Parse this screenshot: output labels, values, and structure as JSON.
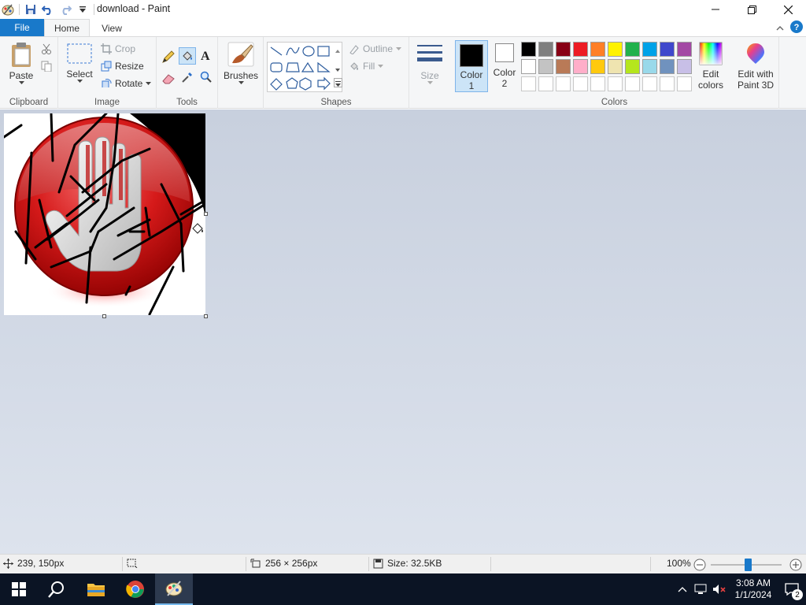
{
  "window": {
    "title": "download - Paint"
  },
  "tabs": {
    "file": "File",
    "home": "Home",
    "view": "View"
  },
  "clipboard": {
    "paste": "Paste",
    "label": "Clipboard"
  },
  "image_group": {
    "select": "Select",
    "crop": "Crop",
    "resize": "Resize",
    "rotate": "Rotate",
    "label": "Image"
  },
  "tools": {
    "label": "Tools"
  },
  "brushes": {
    "label": "Brushes"
  },
  "shapes": {
    "outline": "Outline",
    "fill": "Fill",
    "label": "Shapes"
  },
  "size": {
    "label": "Size"
  },
  "colors": {
    "color1_label": "Color",
    "color1_num": "1",
    "color2_label": "Color",
    "color2_num": "2",
    "edit_colors_line1": "Edit",
    "edit_colors_line2": "colors",
    "paint3d_line1": "Edit with",
    "paint3d_line2": "Paint 3D",
    "label": "Colors",
    "color1_value": "#000000",
    "color2_value": "#ffffff",
    "palette_row1": [
      "#000000",
      "#7f7f7f",
      "#880015",
      "#ed1c24",
      "#ff7f27",
      "#fff200",
      "#22b14c",
      "#00a2e8",
      "#3f48cc",
      "#a349a4"
    ],
    "palette_row2": [
      "#ffffff",
      "#c3c3c3",
      "#b97a57",
      "#ffaec9",
      "#ffc90e",
      "#efe4b0",
      "#b5e61d",
      "#99d9ea",
      "#7092be",
      "#c8bfe7"
    ],
    "palette_row3": [
      "#ffffff",
      "#ffffff",
      "#ffffff",
      "#ffffff",
      "#ffffff",
      "#ffffff",
      "#ffffff",
      "#ffffff",
      "#ffffff",
      "#ffffff"
    ]
  },
  "status": {
    "cursor_pos": "239, 150px",
    "image_dims": "256 × 256px",
    "file_size": "Size: 32.5KB",
    "zoom": "100%"
  },
  "taskbar": {
    "time": "3:08 AM",
    "date": "1/1/2024",
    "notification_count": "2"
  }
}
